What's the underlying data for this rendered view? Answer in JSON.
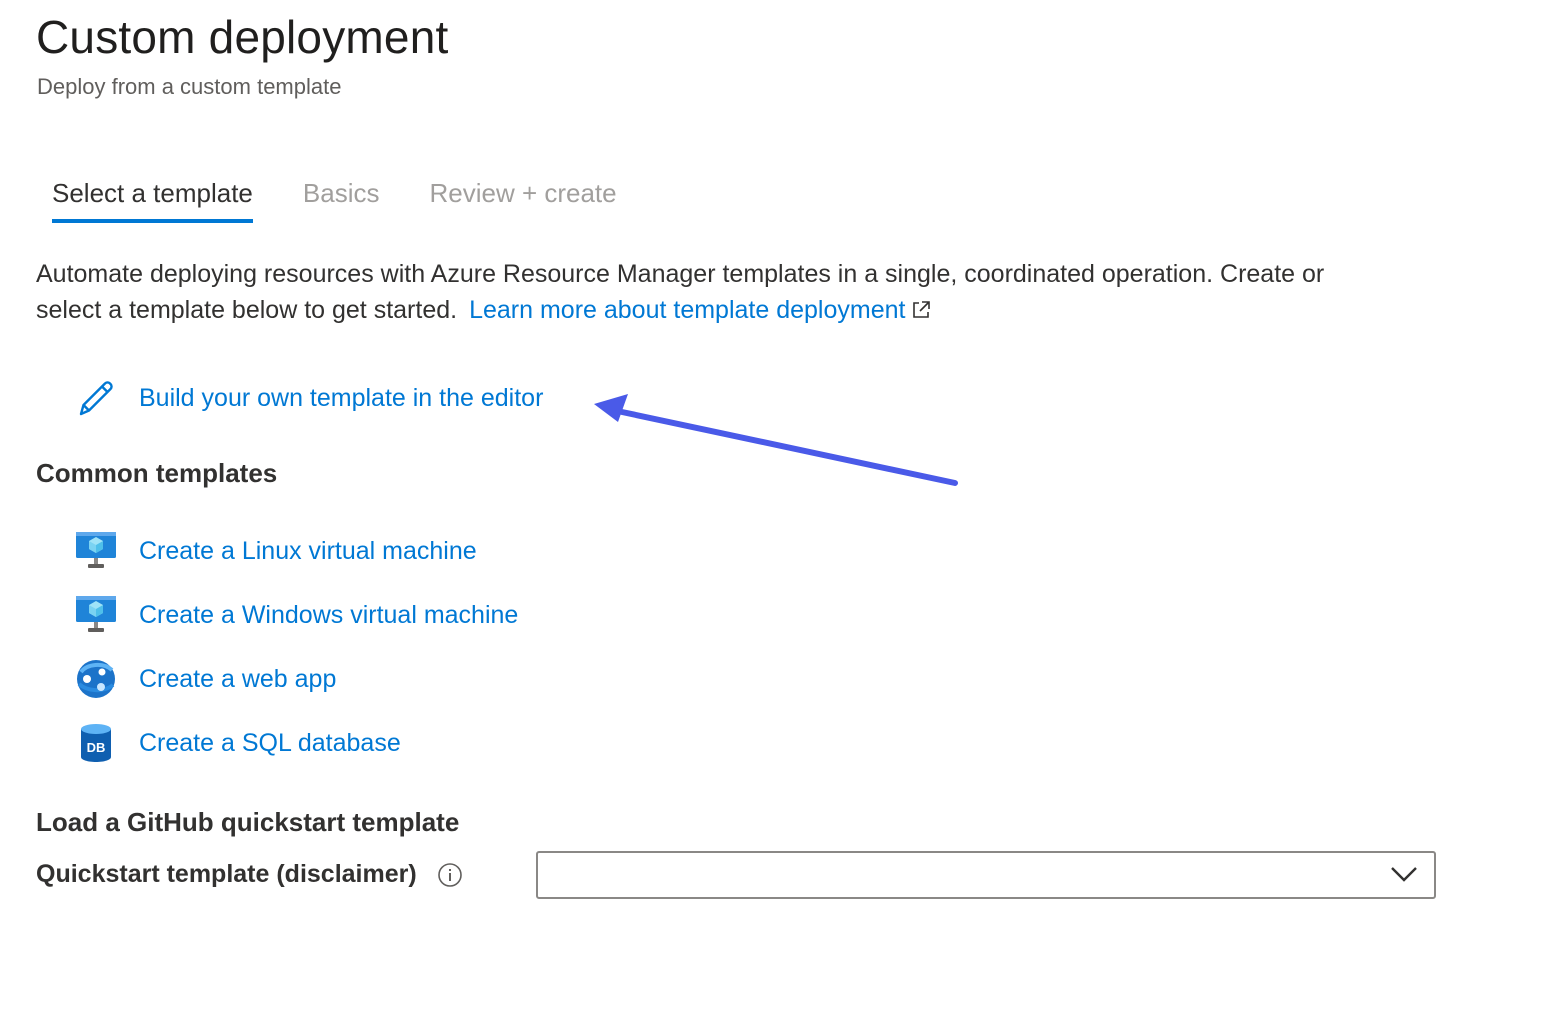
{
  "header": {
    "title": "Custom deployment",
    "subtitle": "Deploy from a custom template"
  },
  "tabs": [
    {
      "label": "Select a template",
      "active": true
    },
    {
      "label": "Basics",
      "active": false
    },
    {
      "label": "Review + create",
      "active": false
    }
  ],
  "description": {
    "text": "Automate deploying resources with Azure Resource Manager templates in a single, coordinated operation. Create or select a template below to get started.",
    "learn_more_label": "Learn more about template deployment"
  },
  "build_own": {
    "label": "Build your own template in the editor",
    "icon": "pencil-icon"
  },
  "common_templates": {
    "heading": "Common templates",
    "items": [
      {
        "label": "Create a Linux virtual machine",
        "icon": "virtual-machine-icon"
      },
      {
        "label": "Create a Windows virtual machine",
        "icon": "virtual-machine-icon"
      },
      {
        "label": "Create a web app",
        "icon": "web-app-icon"
      },
      {
        "label": "Create a SQL database",
        "icon": "sql-database-icon"
      }
    ]
  },
  "github": {
    "heading": "Load a GitHub quickstart template",
    "field_label": "Quickstart template (disclaimer)",
    "selected_value": ""
  },
  "db_icon_text": "DB",
  "colors": {
    "accent": "#0078d4",
    "annotation_arrow": "#4a5ae8"
  }
}
